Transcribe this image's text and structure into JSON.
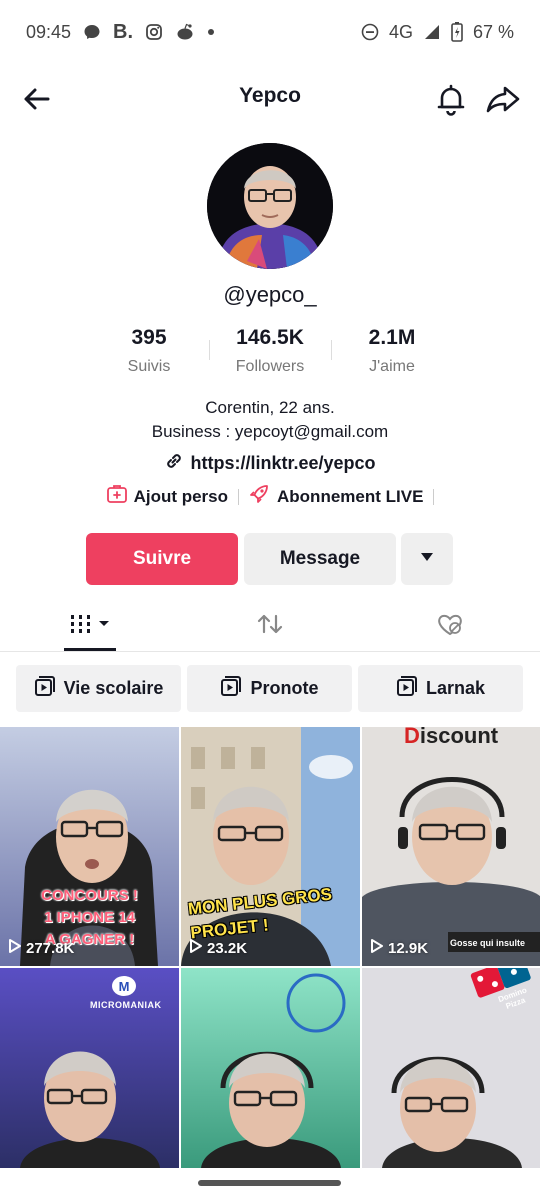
{
  "status_bar": {
    "time": "09:45",
    "network": "4G",
    "battery": "67 %"
  },
  "header": {
    "title": "Yepco"
  },
  "profile": {
    "username": "@yepco_",
    "stats": [
      {
        "value": "395",
        "label": "Suivis"
      },
      {
        "value": "146.5K",
        "label": "Followers"
      },
      {
        "value": "2.1M",
        "label": "J'aime"
      }
    ],
    "bio_line1": "Corentin, 22 ans.",
    "bio_line2": "Business : yepcoyt@gmail.com",
    "link": "https://linktr.ee/yepco",
    "chip1": "Ajout perso",
    "chip2": "Abonnement LIVE"
  },
  "actions": {
    "follow": "Suivre",
    "message": "Message"
  },
  "playlists": [
    "Vie scolaire",
    "Pronote",
    "Larnak"
  ],
  "videos": [
    {
      "views": "277.8K",
      "overlay": [
        "CONCOURS !",
        "1 IPHONE 14",
        "A GAGNER !"
      ],
      "bg_top": "#b9c3db",
      "bg_bottom": "#6b73a8"
    },
    {
      "views": "23.2K",
      "overlay": [
        "MON PLUS GROS",
        "PROJET !"
      ],
      "bg_top": "#d9d2c3",
      "bg_bottom": "#6f6a5e"
    },
    {
      "views": "12.9K",
      "overlay_brand": "Discount",
      "caption": "Gosse qui insulte",
      "bg_top": "#e9e6e4",
      "bg_bottom": "#707a86"
    },
    {
      "brand": "MICROMANIAK",
      "bg_top": "#4c47b6",
      "bg_bottom": "#2b2e6a"
    },
    {
      "bg_top": "#8fe3c6",
      "bg_bottom": "#2e8f72"
    },
    {
      "brand": "Domino Pizza",
      "bg_top": "#dedde2",
      "bg_bottom": "#6c6f7a"
    }
  ],
  "colors": {
    "accent": "#ee4060",
    "text": "#161823",
    "muted": "#777777"
  }
}
